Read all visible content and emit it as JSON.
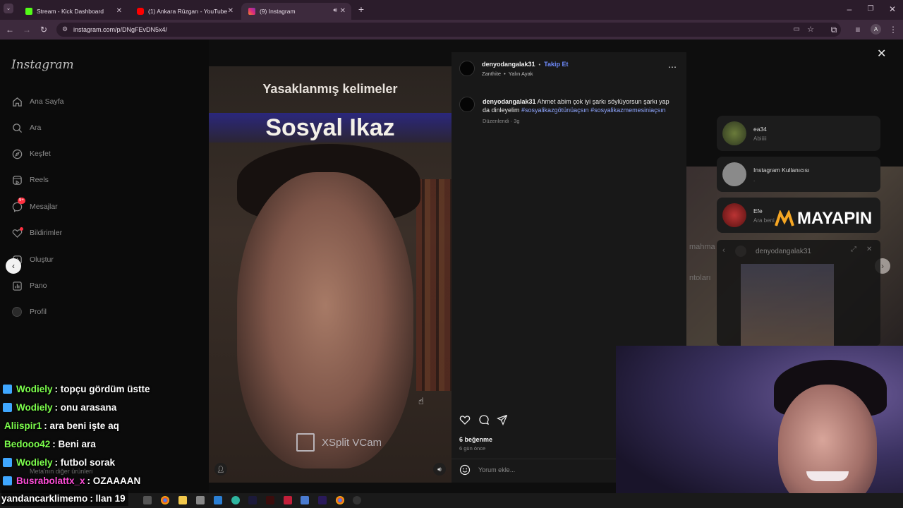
{
  "tabs": [
    {
      "title": "Stream - Kick Dashboard",
      "color": "#53fc18"
    },
    {
      "title": "(1) Ankara Rüzgarı - YouTube",
      "color": "#ff0000"
    },
    {
      "title": "(9) Instagram",
      "color": "#e1306c"
    }
  ],
  "address": {
    "url": "instagram.com/p/DNgFEvDN5x4/"
  },
  "profile_initial": "A",
  "sidebar": {
    "logo": "Instagram",
    "items": [
      {
        "label": "Ana Sayfa"
      },
      {
        "label": "Ara"
      },
      {
        "label": "Keşfet"
      },
      {
        "label": "Reels"
      },
      {
        "label": "Mesajlar"
      },
      {
        "label": "Bildirimler"
      },
      {
        "label": "Oluştur"
      },
      {
        "label": "Pano"
      },
      {
        "label": "Profil"
      }
    ],
    "messages_badge": "9+"
  },
  "video": {
    "title_line1": "Yasaklanmış kelimeler",
    "title_line2": "Sosyal Ikaz",
    "watermark": "XSplit VCam"
  },
  "post": {
    "username": "denyodangalak31",
    "follow": "Takip Et",
    "audio_artist": "Zanthite",
    "audio_title": "Yalın Ayak",
    "caption_user": "denyodangalak31",
    "caption_text": "Ahmet abim çok iyi şarkı söylüyorsun şarkı yap da dinleyelim",
    "hashtag1": "#sosyalikazgötünüaçsın",
    "hashtag2": "#sosyalikazmemesiniaçsın",
    "edited": "Düzenlendi · 3g",
    "likes": "6 beğenme",
    "posted": "6 gün önce",
    "comment_placeholder": "Yorum ekle..."
  },
  "suggestions": [
    {
      "name": "ea34",
      "sub": "Abiiiii"
    },
    {
      "name": "Instagram Kullanıcısı",
      "sub": "."
    },
    {
      "name": "Efe",
      "sub": "Ara beni"
    }
  ],
  "overlay": {
    "brand": "MAYAPIN",
    "popup_user": "denyodangalak31",
    "bg_text1": "mahma",
    "bg_text2": "ntoları"
  },
  "chat": [
    {
      "user": "Wodiely",
      "msg": ": topçu gördüm üstte",
      "color": "#7dff4d",
      "badge": true
    },
    {
      "user": "Wodiely",
      "msg": ": onu arasana",
      "color": "#7dff4d",
      "badge": true
    },
    {
      "user": "Aliispir1",
      "msg": ": ara beni işte aq",
      "color": "#7dff4d",
      "badge": false
    },
    {
      "user": "Bedooo42",
      "msg": ": Beni ara",
      "color": "#7dff4d",
      "badge": false
    },
    {
      "user": "Wodiely",
      "msg": ": futbol sorak",
      "color": "#7dff4d",
      "badge": true
    },
    {
      "user": "Busrabolattx_x",
      "msg": ": OZAAAAN",
      "color": "#ff4dd8",
      "badge": true
    },
    {
      "user": "yandancarklimemo",
      "msg": ": llan 19",
      "color": "#ffffff",
      "badge": false
    }
  ],
  "meta_text": "Meta'nın diğer ürünleri"
}
